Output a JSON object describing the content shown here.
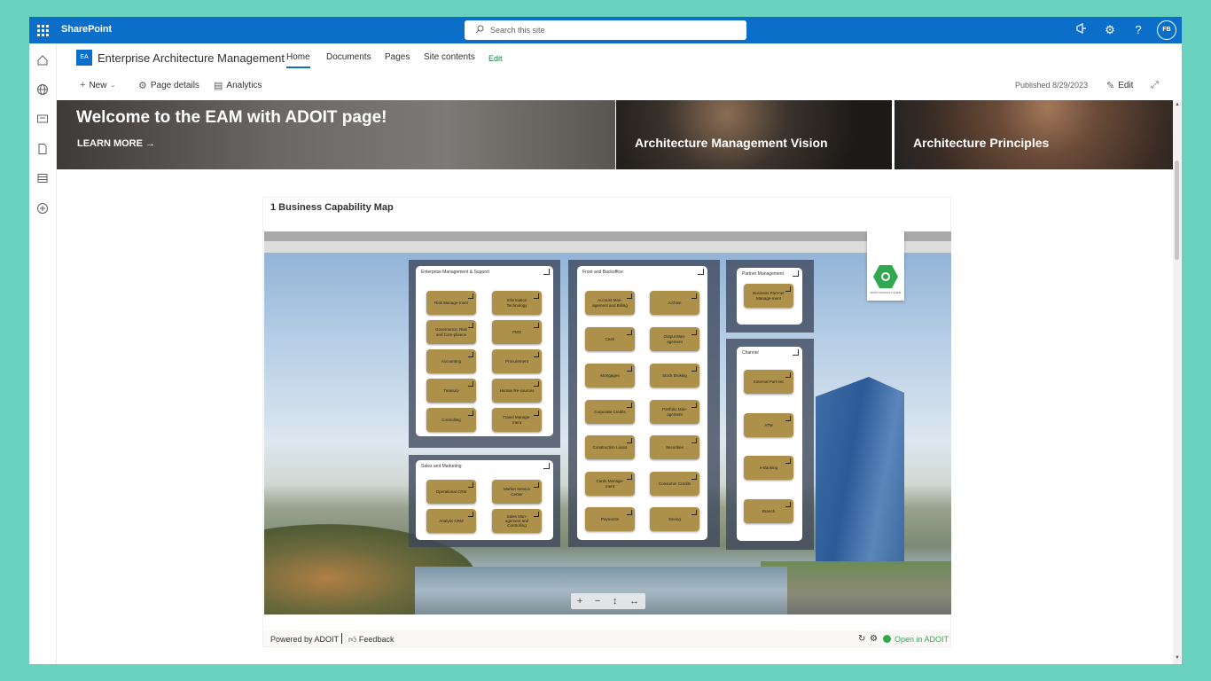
{
  "suite_bar": {
    "brand": "SharePoint",
    "search_placeholder": "Search this site",
    "user_initials": "FB",
    "icons": [
      "app-launcher-icon",
      "megaphone-icon",
      "gear-icon",
      "help-icon"
    ]
  },
  "site": {
    "logo_text": "EA",
    "title": "Enterprise Architecture Management",
    "nav": [
      "Home",
      "Documents",
      "Pages",
      "Site contents",
      "Edit"
    ],
    "active_nav": "Home"
  },
  "command_bar": {
    "new_label": "New",
    "page_details_label": "Page details",
    "analytics_label": "Analytics",
    "published": "Published 8/29/2023",
    "edit_label": "Edit"
  },
  "hero": {
    "title": "Welcome to the EAM with ADOIT page!",
    "learn_more": "LEARN MORE",
    "tiles": [
      "Architecture Management Vision",
      "Architecture Principles"
    ]
  },
  "webpart": {
    "title": "1 Business Capability Map",
    "badge_text": "ADOIT PRODUCT GUIDE",
    "groups": {
      "ems": {
        "label": "Enterprise Management & Support",
        "items": [
          "Risk Manage-ment",
          "Information Technology",
          "Governance, Risk and Com-pliance",
          "PMO",
          "Accounting",
          "Procurement",
          "Treasury",
          "Human Re-sources",
          "Controlling",
          "Travel Manage-ment"
        ]
      },
      "sm": {
        "label": "Sales and Marketing",
        "items": [
          "Operational CRM",
          "Market Service Center",
          "Analytic CRM",
          "Sales Man-agement and Controlling"
        ]
      },
      "fb": {
        "label": "Front and Backoffice",
        "items": [
          "Account Man-agement and Billing",
          "Archive",
          "Cash",
          "Output Man-agement",
          "Mortgages",
          "Stock Broking",
          "Corporate Credits",
          "Portfolio Man-agement",
          "Construction Loans",
          "Securities",
          "Cards Manage-ment",
          "Consumer Credits",
          "Payments",
          "Saving"
        ]
      },
      "pm": {
        "label": "Partner Management",
        "items": [
          "Business Part-ner Manage-ment"
        ]
      },
      "ch": {
        "label": "Channel",
        "items": [
          "External Part-ner",
          "ATM",
          "e-Banking",
          "Branch"
        ]
      }
    },
    "footer": {
      "powered": "Powered by ADOIT",
      "feedback": "Feedback",
      "open": "Open in ADOIT"
    }
  },
  "colors": {
    "suite_bar": "#0b6fc9",
    "background": "#6ad1bf",
    "capability": "#ad9049",
    "adoit_green": "#2fa84f"
  }
}
